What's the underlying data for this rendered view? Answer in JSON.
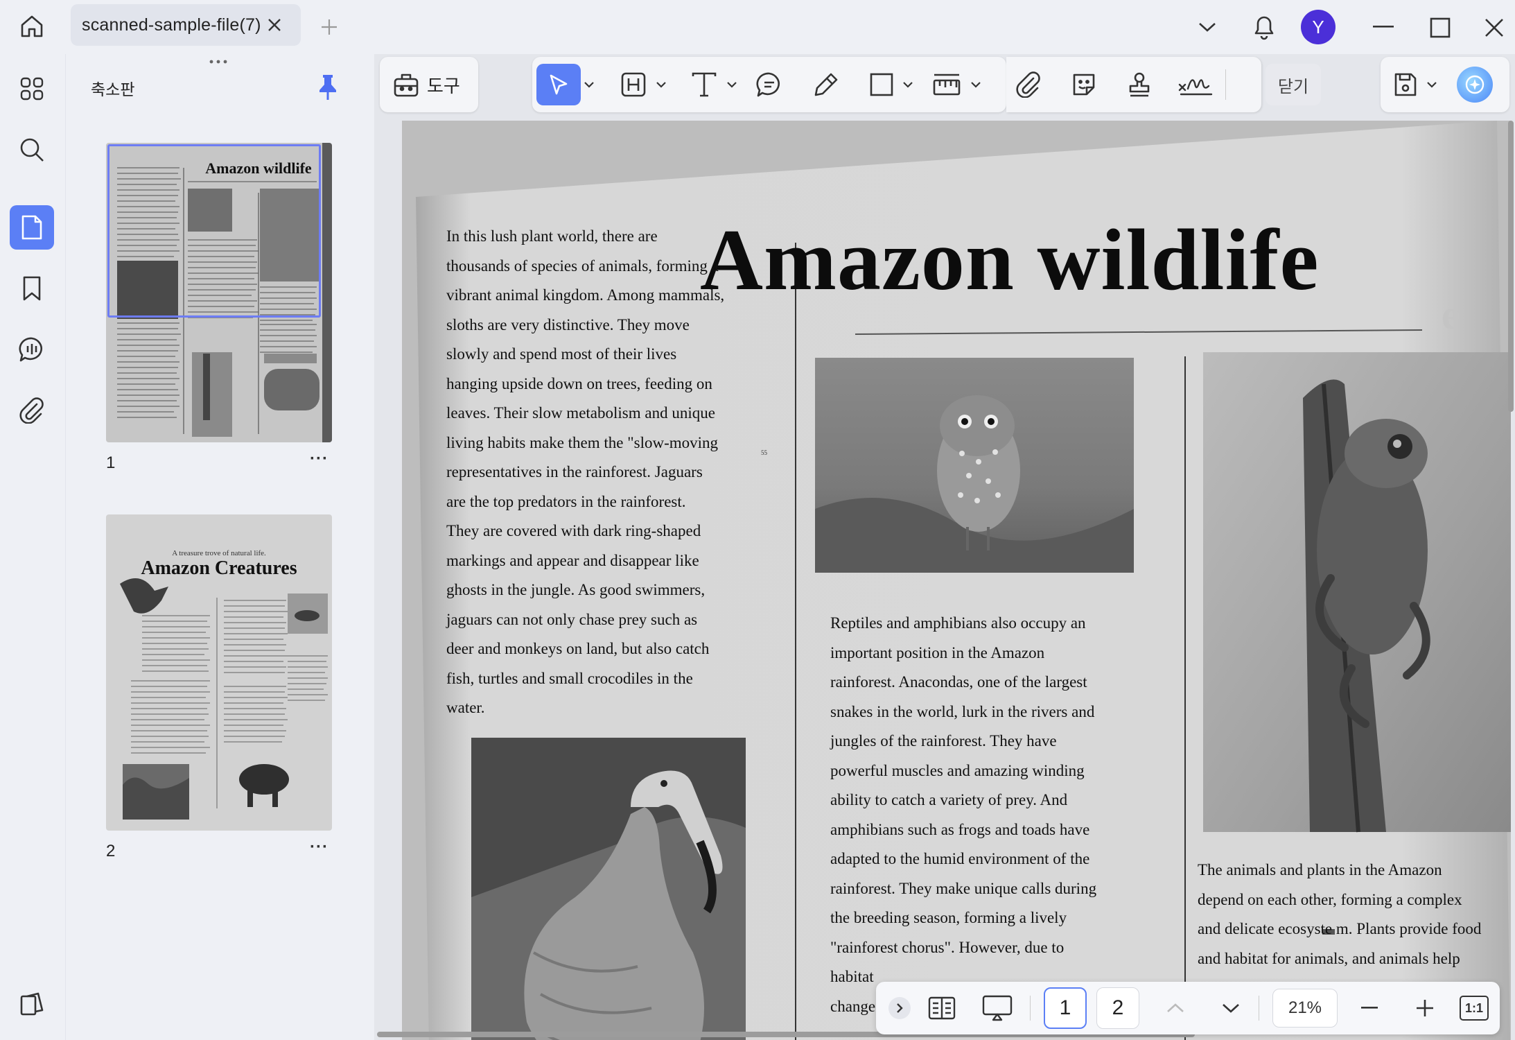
{
  "titlebar": {
    "tab_title": "scanned-sample-file(7)",
    "avatar_letter": "Y"
  },
  "thumbnail_panel": {
    "title": "축소판",
    "pages": [
      {
        "number": "1",
        "page_title": "Amazon wildlife"
      },
      {
        "number": "2",
        "page_subtitle": "A treasure trove of natural life.",
        "page_title": "Amazon Creatures"
      }
    ]
  },
  "toolbar": {
    "tools_label": "도구",
    "close_label": "닫기"
  },
  "document": {
    "title": "Amazon wildlife",
    "col1": [
      "In this lush plant world, there are",
      "thousands of species of animals, forming a",
      "vibrant animal kingdom. Among mammals,",
      "sloths are very distinctive. They move",
      "slowly and spend most of their lives",
      "hanging upside down on trees, feeding on",
      "leaves. Their slow metabolism and unique",
      "living habits make them the \"slow-moving",
      "representatives in the rainforest. Jaguars",
      "are the top predators in the rainforest.",
      "They are covered with dark ring-shaped",
      "markings and appear and disappear like",
      "ghosts in the jungle. As good swimmers,",
      "jaguars can not only chase prey such as",
      "deer and monkeys on land, but also catch",
      "fish, turtles and small crocodiles in the",
      "water."
    ],
    "col2": [
      "Reptiles and amphibians also occupy an",
      "important position in the Amazon",
      "rainforest. Anacondas, one of the largest",
      "snakes in the world, lurk in the rivers and",
      "jungles of the rainforest. They have",
      "powerful muscles and amazing winding",
      "ability to catch a variety of prey. And",
      "amphibians such as frogs and toads have",
      "adapted to the humid environment of the",
      "rainforest. They make unique calls during",
      "the breeding season, forming a lively",
      "\"rainforest chorus\". However, due to",
      "habitat",
      "changes"
    ],
    "col3": [
      "The animals and plants in the Amazon",
      "depend on each other, forming a complex",
      "and delicate ecosyste  m. Plants provide food",
      "and habitat for animals, and animals help"
    ]
  },
  "bottombar": {
    "page_1": "1",
    "page_2": "2",
    "zoom": "21%",
    "fit_label": "1:1"
  },
  "colors": {
    "accent": "#5b7ff5",
    "avatar": "#4b2fd8",
    "pin": "#4e6ef2"
  }
}
